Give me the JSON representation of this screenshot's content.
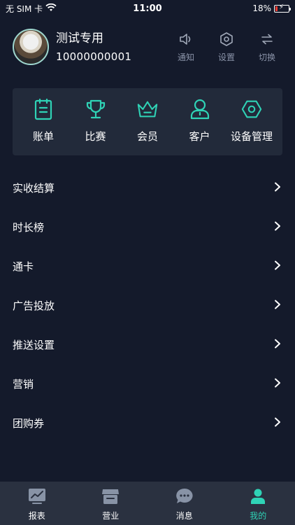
{
  "status_bar": {
    "carrier": "无 SIM 卡",
    "time": "11:00",
    "battery_percent": "18%",
    "battery_level": 0.18,
    "battery_color": "#ff3b30"
  },
  "profile": {
    "name": "测试专用",
    "id": "10000000001"
  },
  "header_actions": [
    {
      "icon": "speaker-icon",
      "label": "通知"
    },
    {
      "icon": "hexagon-gear-icon",
      "label": "设置"
    },
    {
      "icon": "swap-arrows-icon",
      "label": "切换"
    }
  ],
  "features": [
    {
      "icon": "bill-clipboard-icon",
      "label": "账单"
    },
    {
      "icon": "trophy-icon",
      "label": "比赛"
    },
    {
      "icon": "crown-icon",
      "label": "会员"
    },
    {
      "icon": "person-icon",
      "label": "客户"
    },
    {
      "icon": "hexagon-nut-icon",
      "label": "设备管理"
    }
  ],
  "menu": [
    {
      "label": "实收结算"
    },
    {
      "label": "时长榜"
    },
    {
      "label": "通卡"
    },
    {
      "label": "广告投放"
    },
    {
      "label": "推送设置"
    },
    {
      "label": "营销"
    },
    {
      "label": "团购券"
    }
  ],
  "tabs": [
    {
      "icon": "report-chart-icon",
      "label": "报表",
      "active": false
    },
    {
      "icon": "store-icon",
      "label": "营业",
      "active": false
    },
    {
      "icon": "chat-bubble-icon",
      "label": "消息",
      "active": false
    },
    {
      "icon": "user-profile-icon",
      "label": "我的",
      "active": true
    }
  ],
  "colors": {
    "background": "#141a2b",
    "card": "#222a3a",
    "accent": "#2fd3b6",
    "muted": "#8a93a8",
    "tab_bar": "#2a3140",
    "tab_icon_inactive": "#8893a6"
  }
}
